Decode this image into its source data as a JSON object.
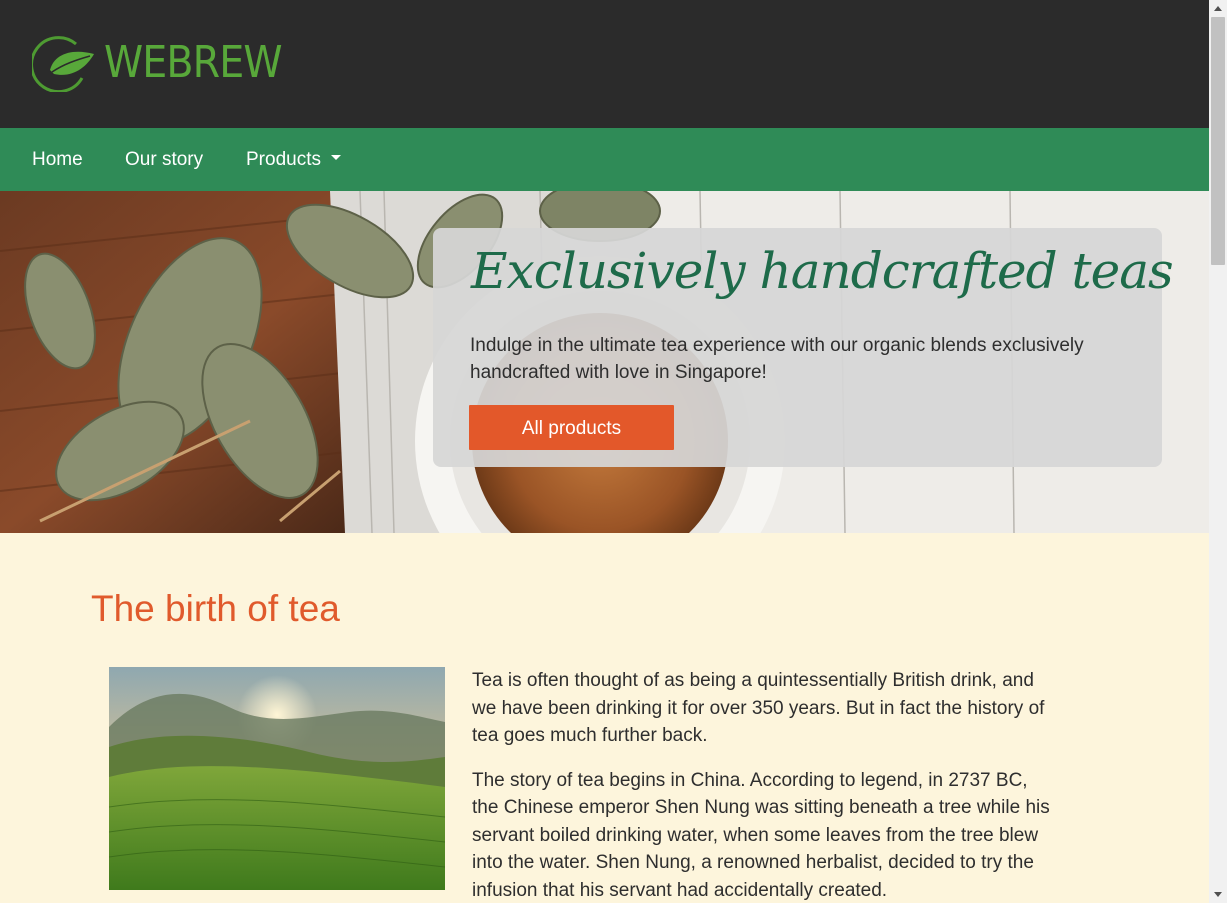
{
  "brand": {
    "name": "WEBREW",
    "logo_icon": "leaf-circle-icon",
    "logo_color": "#58a83a"
  },
  "nav": {
    "items": [
      {
        "label": "Home"
      },
      {
        "label": "Our story"
      },
      {
        "label": "Products",
        "dropdown": true
      }
    ],
    "background": "#2f8b57"
  },
  "hero": {
    "title": "Exclusively handcrafted teas",
    "text": "Indulge in the ultimate tea experience with our organic blends exclusively handcrafted with love in Singapore!",
    "button_label": "All products",
    "button_color": "#e3582a",
    "image": "tea-leaves-and-cup-photo"
  },
  "section": {
    "title": "The birth of tea",
    "image": "tea-plantation-sunrise-photo",
    "paragraphs": [
      "Tea is often thought of as being a quintessentially British drink, and we have been drinking it for over 350 years. But in fact the history of tea goes much further back.",
      "The story of tea begins in China. According to legend, in 2737 BC, the Chinese emperor Shen Nung was sitting beneath a tree while his servant boiled drinking water, when some leaves from the tree blew into the water. Shen Nung, a renowned herbalist, decided to try the infusion that his servant had accidentally created."
    ]
  },
  "colors": {
    "header_bg": "#2b2b2b",
    "content_bg": "#fdf5dc",
    "accent": "#e05a2c"
  }
}
